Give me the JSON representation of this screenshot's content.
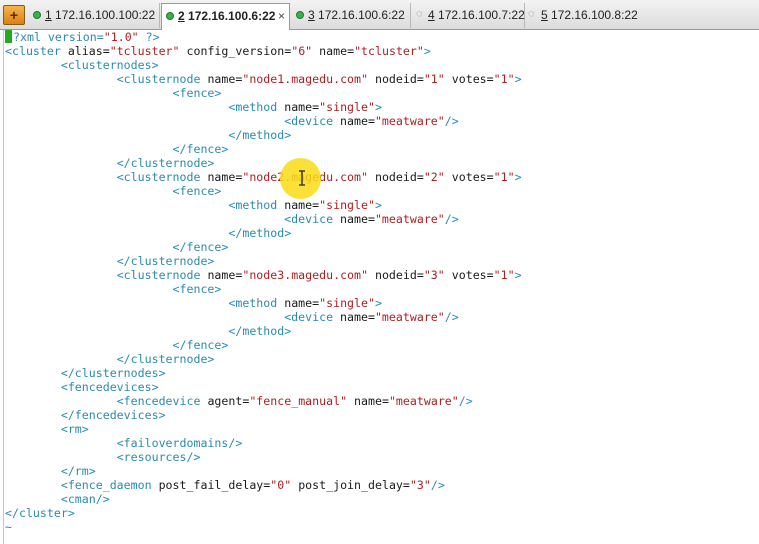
{
  "tabs": [
    {
      "num": "1",
      "host": "172.16.100.100:22",
      "status": "connected",
      "active": false
    },
    {
      "num": "2",
      "host": "172.16.100.6:22",
      "status": "connected",
      "active": true
    },
    {
      "num": "3",
      "host": "172.16.100.6:22",
      "status": "connected",
      "active": false
    },
    {
      "num": "4",
      "host": "172.16.100.7:22",
      "status": "disconnected",
      "active": false
    },
    {
      "num": "5",
      "host": "172.16.100.8:22",
      "status": "disconnected",
      "active": false
    }
  ],
  "tab_close_glyph": "×",
  "new_tab_glyph": "+",
  "editor_lines": [
    [
      [
        "pi",
        "?xml version="
      ],
      [
        "val",
        "\"1.0\""
      ],
      [
        "pi",
        " ?>"
      ]
    ],
    [
      [
        "tag",
        "<cluster "
      ],
      [
        "attr",
        "alias="
      ],
      [
        "val",
        "\"tcluster\""
      ],
      [
        "attr",
        " config_version="
      ],
      [
        "val",
        "\"6\""
      ],
      [
        "attr",
        " name="
      ],
      [
        "val",
        "\"tcluster\""
      ],
      [
        "tag",
        ">"
      ]
    ],
    [
      [
        "sp",
        "        "
      ],
      [
        "tag",
        "<clusternodes>"
      ]
    ],
    [
      [
        "sp",
        "                "
      ],
      [
        "tag",
        "<clusternode "
      ],
      [
        "attr",
        "name="
      ],
      [
        "val",
        "\"node1.magedu.com\""
      ],
      [
        "attr",
        " nodeid="
      ],
      [
        "val",
        "\"1\""
      ],
      [
        "attr",
        " votes="
      ],
      [
        "val",
        "\"1\""
      ],
      [
        "tag",
        ">"
      ]
    ],
    [
      [
        "sp",
        "                        "
      ],
      [
        "tag",
        "<fence>"
      ]
    ],
    [
      [
        "sp",
        "                                "
      ],
      [
        "tag",
        "<method "
      ],
      [
        "attr",
        "name="
      ],
      [
        "val",
        "\"single\""
      ],
      [
        "tag",
        ">"
      ]
    ],
    [
      [
        "sp",
        "                                        "
      ],
      [
        "tag",
        "<device "
      ],
      [
        "attr",
        "name="
      ],
      [
        "val",
        "\"meatware\""
      ],
      [
        "tag",
        "/>"
      ]
    ],
    [
      [
        "sp",
        "                                "
      ],
      [
        "tag",
        "</method>"
      ]
    ],
    [
      [
        "sp",
        "                        "
      ],
      [
        "tag",
        "</fence>"
      ]
    ],
    [
      [
        "sp",
        "                "
      ],
      [
        "tag",
        "</clusternode>"
      ]
    ],
    [
      [
        "sp",
        "                "
      ],
      [
        "tag",
        "<clusternode "
      ],
      [
        "attr",
        "name="
      ],
      [
        "val",
        "\"node2.magedu.com\""
      ],
      [
        "attr",
        " nodeid="
      ],
      [
        "val",
        "\"2\""
      ],
      [
        "attr",
        " votes="
      ],
      [
        "val",
        "\"1\""
      ],
      [
        "tag",
        ">"
      ]
    ],
    [
      [
        "sp",
        "                        "
      ],
      [
        "tag",
        "<fence>"
      ]
    ],
    [
      [
        "sp",
        "                                "
      ],
      [
        "tag",
        "<method "
      ],
      [
        "attr",
        "name="
      ],
      [
        "val",
        "\"single\""
      ],
      [
        "tag",
        ">"
      ]
    ],
    [
      [
        "sp",
        "                                        "
      ],
      [
        "tag",
        "<device "
      ],
      [
        "attr",
        "name="
      ],
      [
        "val",
        "\"meatware\""
      ],
      [
        "tag",
        "/>"
      ]
    ],
    [
      [
        "sp",
        "                                "
      ],
      [
        "tag",
        "</method>"
      ]
    ],
    [
      [
        "sp",
        "                        "
      ],
      [
        "tag",
        "</fence>"
      ]
    ],
    [
      [
        "sp",
        "                "
      ],
      [
        "tag",
        "</clusternode>"
      ]
    ],
    [
      [
        "sp",
        "                "
      ],
      [
        "tag",
        "<clusternode "
      ],
      [
        "attr",
        "name="
      ],
      [
        "val",
        "\"node3.magedu.com\""
      ],
      [
        "attr",
        " nodeid="
      ],
      [
        "val",
        "\"3\""
      ],
      [
        "attr",
        " votes="
      ],
      [
        "val",
        "\"1\""
      ],
      [
        "tag",
        ">"
      ]
    ],
    [
      [
        "sp",
        "                        "
      ],
      [
        "tag",
        "<fence>"
      ]
    ],
    [
      [
        "sp",
        "                                "
      ],
      [
        "tag",
        "<method "
      ],
      [
        "attr",
        "name="
      ],
      [
        "val",
        "\"single\""
      ],
      [
        "tag",
        ">"
      ]
    ],
    [
      [
        "sp",
        "                                        "
      ],
      [
        "tag",
        "<device "
      ],
      [
        "attr",
        "name="
      ],
      [
        "val",
        "\"meatware\""
      ],
      [
        "tag",
        "/>"
      ]
    ],
    [
      [
        "sp",
        "                                "
      ],
      [
        "tag",
        "</method>"
      ]
    ],
    [
      [
        "sp",
        "                        "
      ],
      [
        "tag",
        "</fence>"
      ]
    ],
    [
      [
        "sp",
        "                "
      ],
      [
        "tag",
        "</clusternode>"
      ]
    ],
    [
      [
        "sp",
        "        "
      ],
      [
        "tag",
        "</clusternodes>"
      ]
    ],
    [
      [
        "sp",
        "        "
      ],
      [
        "tag",
        "<fencedevices>"
      ]
    ],
    [
      [
        "sp",
        "                "
      ],
      [
        "tag",
        "<fencedevice "
      ],
      [
        "attr",
        "agent="
      ],
      [
        "val",
        "\"fence_manual\""
      ],
      [
        "attr",
        " name="
      ],
      [
        "val",
        "\"meatware\""
      ],
      [
        "tag",
        "/>"
      ]
    ],
    [
      [
        "sp",
        "        "
      ],
      [
        "tag",
        "</fencedevices>"
      ]
    ],
    [
      [
        "sp",
        "        "
      ],
      [
        "tag",
        "<rm>"
      ]
    ],
    [
      [
        "sp",
        "                "
      ],
      [
        "tag",
        "<failoverdomains/>"
      ]
    ],
    [
      [
        "sp",
        "                "
      ],
      [
        "tag",
        "<resources/>"
      ]
    ],
    [
      [
        "sp",
        "        "
      ],
      [
        "tag",
        "</rm>"
      ]
    ],
    [
      [
        "sp",
        "        "
      ],
      [
        "tag",
        "<fence_daemon "
      ],
      [
        "attr",
        "post_fail_delay="
      ],
      [
        "val",
        "\"0\""
      ],
      [
        "attr",
        " post_join_delay="
      ],
      [
        "val",
        "\"3\""
      ],
      [
        "tag",
        "/>"
      ]
    ],
    [
      [
        "sp",
        "        "
      ],
      [
        "tag",
        "<cman/>"
      ]
    ],
    [
      [
        "tag",
        "</cluster>"
      ]
    ],
    [
      [
        "tilde",
        "~"
      ]
    ]
  ],
  "colors": {
    "tag": "#2a8ab0",
    "value": "#b01e1e",
    "text": "#1a1a1a",
    "cursor": "#22aa22",
    "tilde": "#3a6fd0",
    "highlight": "#fadc14"
  },
  "icons": {
    "new_tab": "plus-icon",
    "connected": "green-status-icon",
    "disconnected": "disconnected-status-icon",
    "pointer": "i-beam-cursor-icon"
  }
}
